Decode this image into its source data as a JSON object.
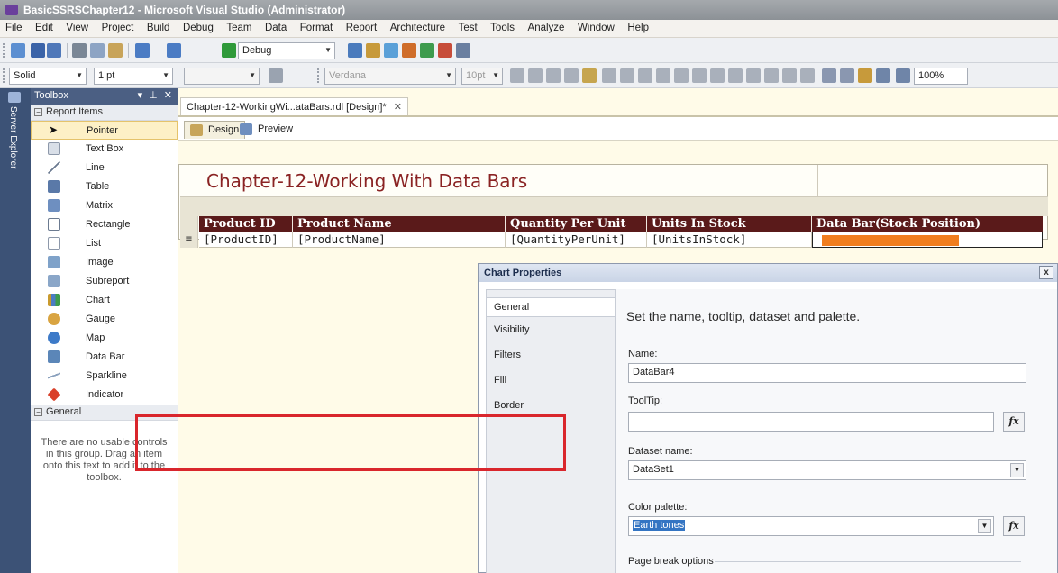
{
  "window": {
    "title": "BasicSSRSChapter12 - Microsoft Visual Studio (Administrator)"
  },
  "menu": [
    "File",
    "Edit",
    "View",
    "Project",
    "Build",
    "Debug",
    "Team",
    "Data",
    "Format",
    "Report",
    "Architecture",
    "Test",
    "Tools",
    "Analyze",
    "Window",
    "Help"
  ],
  "toolbar1": {
    "config": "Debug"
  },
  "toolbar2": {
    "border_style": "Solid",
    "border_width": "1 pt",
    "font_family": "Verdana",
    "font_size": "10pt",
    "zoom": "100%"
  },
  "server_explorer": {
    "label": "Server Explorer"
  },
  "toolbox": {
    "title": "Toolbox",
    "header_controls": "▾ ⊥ ✕",
    "group1": "Report Items",
    "items": [
      "Pointer",
      "Text Box",
      "Line",
      "Table",
      "Matrix",
      "Rectangle",
      "List",
      "Image",
      "Subreport",
      "Chart",
      "Gauge",
      "Map",
      "Data Bar",
      "Sparkline",
      "Indicator"
    ],
    "group2": "General",
    "empty_text": "There are no usable controls in this group. Drag an item onto this text to add it to the toolbox."
  },
  "document": {
    "tab_title": "Chapter-12-WorkingWi...ataBars.rdl [Design]*",
    "design_tab": "Design",
    "preview_tab": "Preview"
  },
  "report": {
    "title": "Chapter-12-Working With Data Bars",
    "headers": [
      "Product ID",
      "Product Name",
      "Quantity Per Unit",
      "Units In Stock",
      "Data Bar(Stock Position)"
    ],
    "row": [
      "[ProductID]",
      "[ProductName]",
      "[QuantityPerUnit]",
      "[UnitsInStock]"
    ],
    "row_handle": "≡",
    "databar_fill": 0.65,
    "databar_color": "#f07d1e"
  },
  "dialog": {
    "title": "Chart Properties",
    "close": "x",
    "nav": [
      "General",
      "Visibility",
      "Filters",
      "Fill",
      "Border"
    ],
    "heading": "Set the name, tooltip, dataset and palette.",
    "name_label": "Name:",
    "name_value": "DataBar4",
    "tooltip_label": "ToolTip:",
    "tooltip_value": "",
    "dataset_label": "Dataset name:",
    "dataset_value": "DataSet1",
    "palette_label": "Color palette:",
    "palette_value": "Earth tones",
    "fx": "fx",
    "page_break": "Page break options"
  },
  "colors": {
    "highlight": "#d9262c",
    "header_bg": "#5a1a1a",
    "title_color": "#8a2323"
  }
}
